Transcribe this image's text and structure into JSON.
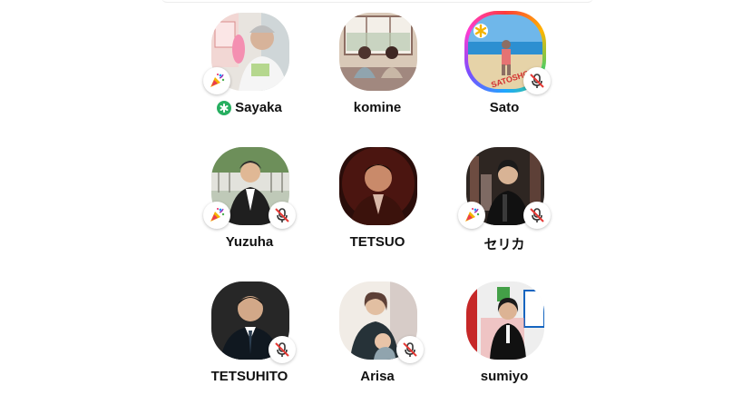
{
  "colors": {
    "accent_green": "#27ae60",
    "mute_red": "#e53935",
    "text": "#111111"
  },
  "speakers": [
    {
      "name": "Sayaka",
      "moderator": true,
      "party_badge": true,
      "muted": false,
      "avatar_icon": "photo-person-icon"
    },
    {
      "name": "komine",
      "moderator": false,
      "party_badge": false,
      "muted": false,
      "avatar_icon": "photo-couple-icon"
    },
    {
      "name": "Sato",
      "moderator": false,
      "party_badge": false,
      "muted": true,
      "avatar_icon": "photo-beach-icon",
      "avatar_overlay_text": "SATOSHOW"
    },
    {
      "name": "Yuzuha",
      "moderator": false,
      "party_badge": true,
      "muted": true,
      "avatar_icon": "photo-person-icon"
    },
    {
      "name": "TETSUO",
      "moderator": false,
      "party_badge": false,
      "muted": false,
      "avatar_icon": "photo-person-icon"
    },
    {
      "name": "セリカ",
      "moderator": false,
      "party_badge": true,
      "muted": true,
      "avatar_icon": "photo-person-icon"
    },
    {
      "name": "TETSUHITO",
      "moderator": false,
      "party_badge": false,
      "muted": true,
      "avatar_icon": "photo-person-icon"
    },
    {
      "name": "Arisa",
      "moderator": false,
      "party_badge": false,
      "muted": true,
      "avatar_icon": "photo-person-icon"
    },
    {
      "name": "sumiyo",
      "moderator": false,
      "party_badge": false,
      "muted": false,
      "avatar_icon": "photo-person-icon"
    }
  ]
}
